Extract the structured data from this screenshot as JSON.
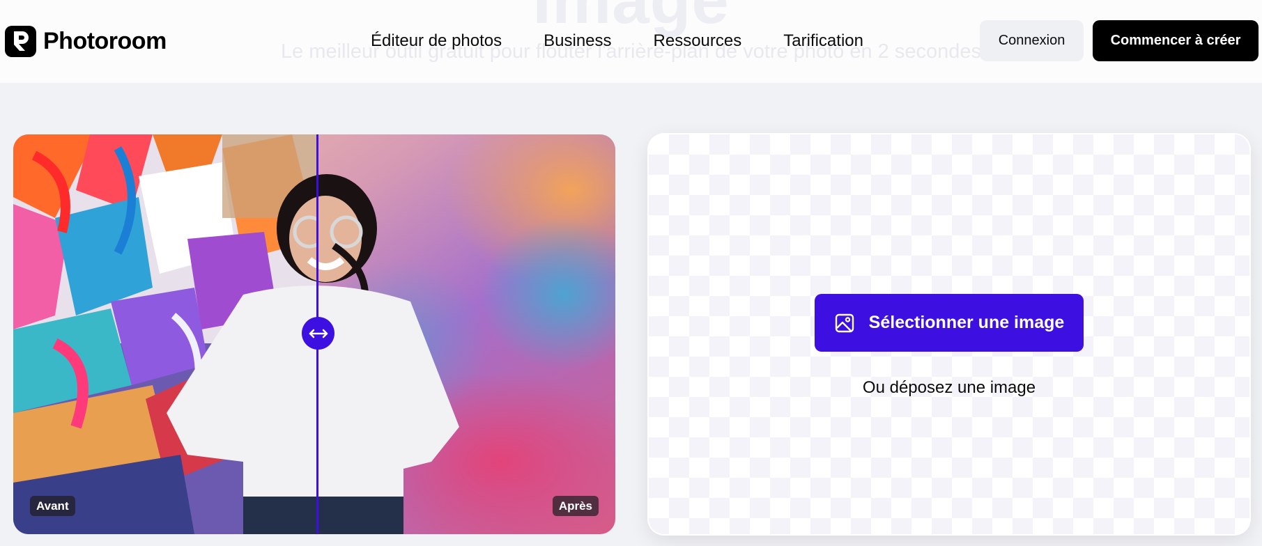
{
  "header": {
    "ghost_title": "Image",
    "ghost_subtitle": "Le meilleur outil gratuit pour flouter l'arrière-plan de votre photo en 2 secondes",
    "brand": "Photoroom",
    "nav": [
      "Éditeur de photos",
      "Business",
      "Ressources",
      "Tarification"
    ],
    "login_label": "Connexion",
    "start_label": "Commencer à créer"
  },
  "compare": {
    "before_label": "Avant",
    "after_label": "Après",
    "slider_icon": "left-right-arrow-icon",
    "divider_color": "#3d0fe0"
  },
  "upload": {
    "select_label": "Sélectionner une image",
    "select_icon": "image-icon",
    "drop_label": "Ou déposez une image",
    "accent_color": "#3d0fe0"
  }
}
